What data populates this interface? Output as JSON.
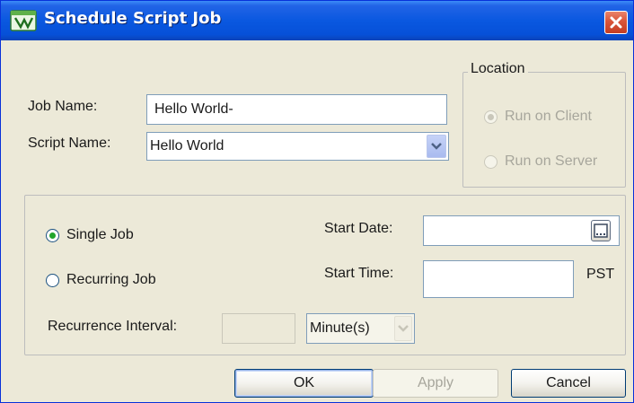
{
  "window": {
    "title": "Schedule Script Job"
  },
  "job_name": {
    "label": "Job Name:",
    "value": "Hello World-"
  },
  "script_name": {
    "label": "Script Name:",
    "value": "Hello World"
  },
  "location": {
    "legend": "Location",
    "options": [
      {
        "label": "Run on Client",
        "selected": true,
        "enabled": false
      },
      {
        "label": "Run on Server",
        "selected": false,
        "enabled": false
      }
    ]
  },
  "job_type": {
    "single_label": "Single Job",
    "recurring_label": "Recurring Job",
    "selected": "Single Job"
  },
  "start_date": {
    "label": "Start Date:",
    "value": ""
  },
  "start_time": {
    "label": "Start Time:",
    "value": "",
    "timezone": "PST"
  },
  "recurrence": {
    "label": "Recurrence Interval:",
    "value": "",
    "unit": "Minute(s)"
  },
  "buttons": {
    "ok": "OK",
    "apply": "Apply",
    "cancel": "Cancel"
  },
  "colors": {
    "titlebar": "#0a58e0",
    "dialog_background": "#ece9d8",
    "radio_selected": "#22a52b",
    "close_button": "#d9553a"
  },
  "icons": {
    "app": "script-job-app-icon",
    "close": "close-icon",
    "dropdown": "chevron-down-icon",
    "calendar": "calendar-icon"
  }
}
